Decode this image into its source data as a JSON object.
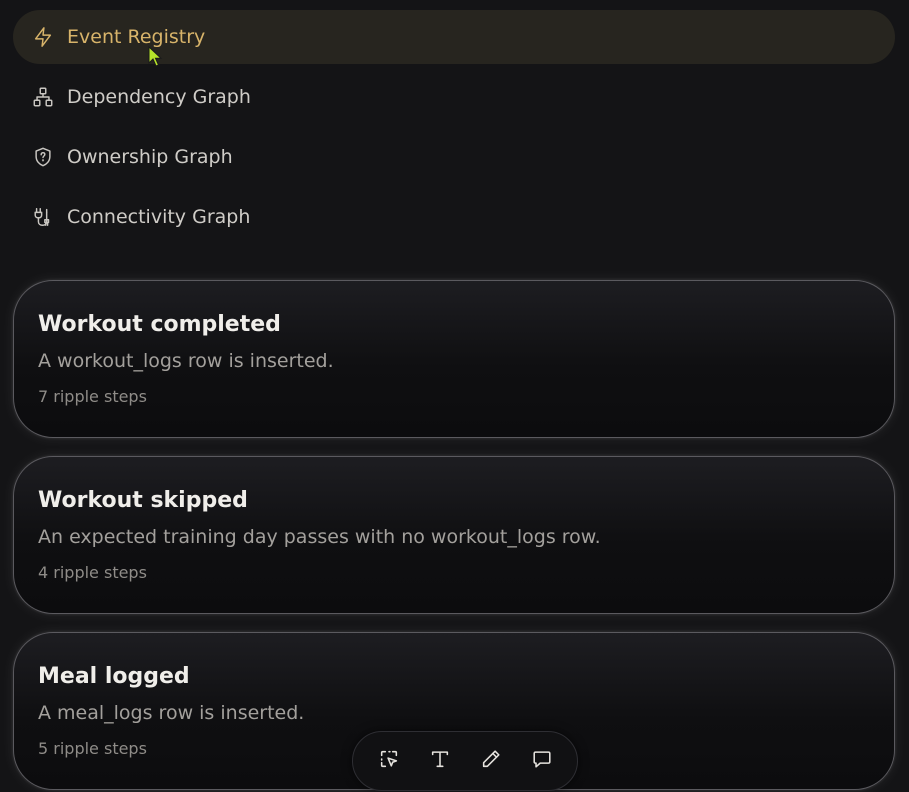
{
  "nav": {
    "items": [
      {
        "label": "Event Registry",
        "icon": "lightning-icon",
        "active": true
      },
      {
        "label": "Dependency Graph",
        "icon": "hierarchy-icon",
        "active": false
      },
      {
        "label": "Ownership Graph",
        "icon": "shield-question-icon",
        "active": false
      },
      {
        "label": "Connectivity Graph",
        "icon": "plug-icon",
        "active": false
      }
    ]
  },
  "events": [
    {
      "title": "Workout completed",
      "description": "A workout_logs row is inserted.",
      "steps": "7 ripple steps"
    },
    {
      "title": "Workout skipped",
      "description": "An expected training day passes with no workout_logs row.",
      "steps": "4 ripple steps"
    },
    {
      "title": "Meal logged",
      "description": "A meal_logs row is inserted.",
      "steps": "5 ripple steps"
    }
  ],
  "toolbar": {
    "tools": [
      {
        "icon": "select-cursor-icon"
      },
      {
        "icon": "text-icon"
      },
      {
        "icon": "pencil-icon"
      },
      {
        "icon": "comment-icon"
      }
    ]
  },
  "colors": {
    "accent": "#d8b46a",
    "background": "#141416",
    "cursor": "#b6e32a"
  }
}
